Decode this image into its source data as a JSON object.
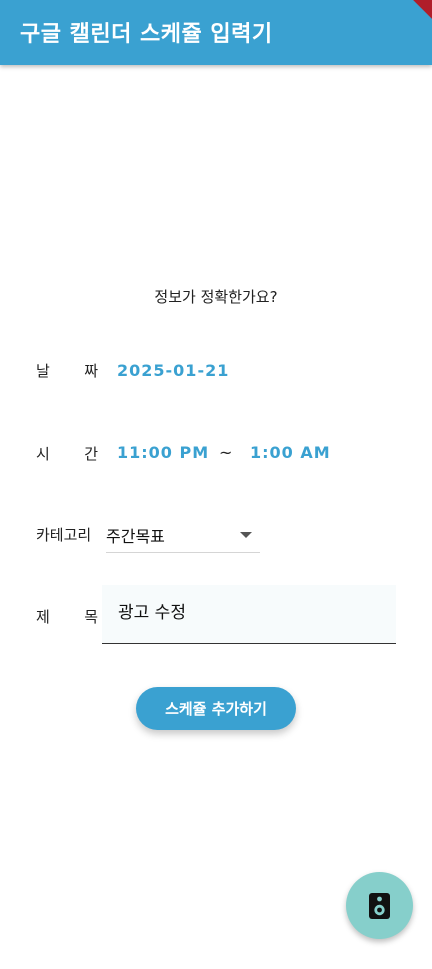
{
  "app_bar": {
    "title": "구글 캘린더 스케쥴 입력기"
  },
  "confirm_text": "정보가 정확한가요?",
  "date": {
    "label_left": "날",
    "label_right": "짜",
    "value": "2025-01-21"
  },
  "time": {
    "label_left": "시",
    "label_right": "간",
    "start": "11:00 PM",
    "separator": "~",
    "end": "1:00 AM"
  },
  "category": {
    "label": "카테고리",
    "selected": "주간목표"
  },
  "title": {
    "label_left": "제",
    "label_right": "목",
    "value": "광고 수정"
  },
  "add_button": {
    "label": "스케쥴 추가하기"
  },
  "fab": {
    "icon": "speaker-icon"
  },
  "colors": {
    "primary": "#3aa1d1",
    "fab": "#86cfcb",
    "debug_banner": "#b01e2a"
  }
}
